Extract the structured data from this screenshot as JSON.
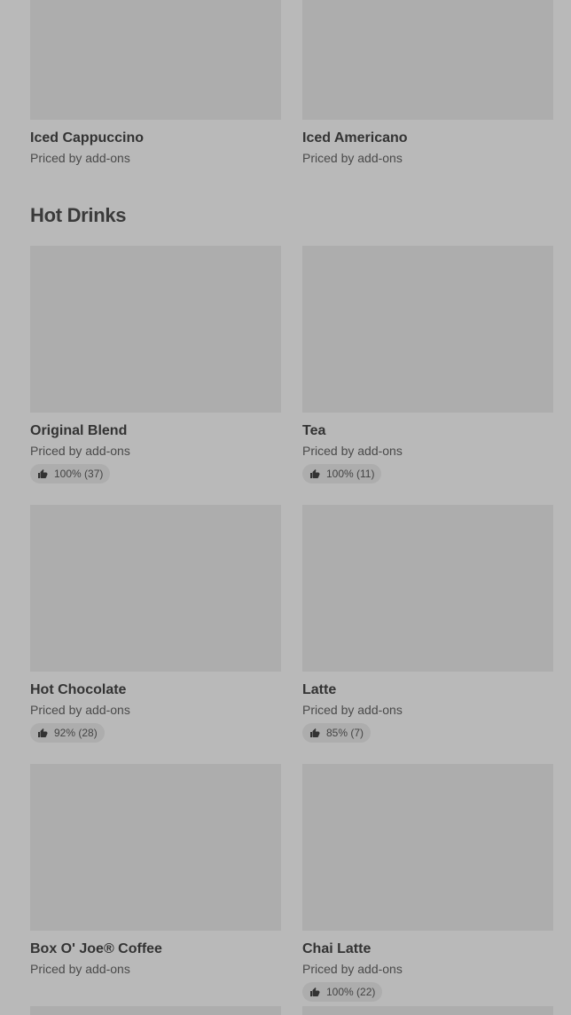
{
  "top_items": [
    {
      "name": "Iced Cappuccino",
      "price": "Priced by add-ons"
    },
    {
      "name": "Iced Americano",
      "price": "Priced by add-ons"
    }
  ],
  "section": {
    "title": "Hot Drinks"
  },
  "items": [
    {
      "name": "Original Blend",
      "price": "Priced by add-ons",
      "rating": "100% (37)"
    },
    {
      "name": "Tea",
      "price": "Priced by add-ons",
      "rating": "100% (11)"
    },
    {
      "name": "Hot Chocolate",
      "price": "Priced by add-ons",
      "rating": "92% (28)"
    },
    {
      "name": "Latte",
      "price": "Priced by add-ons",
      "rating": "85% (7)"
    },
    {
      "name": "Box O' Joe® Coffee",
      "price": "Priced by add-ons",
      "rating": null
    },
    {
      "name": "Chai Latte",
      "price": "Priced by add-ons",
      "rating": "100% (22)"
    }
  ],
  "icons": {
    "rating": "thumbs-up-icon"
  }
}
